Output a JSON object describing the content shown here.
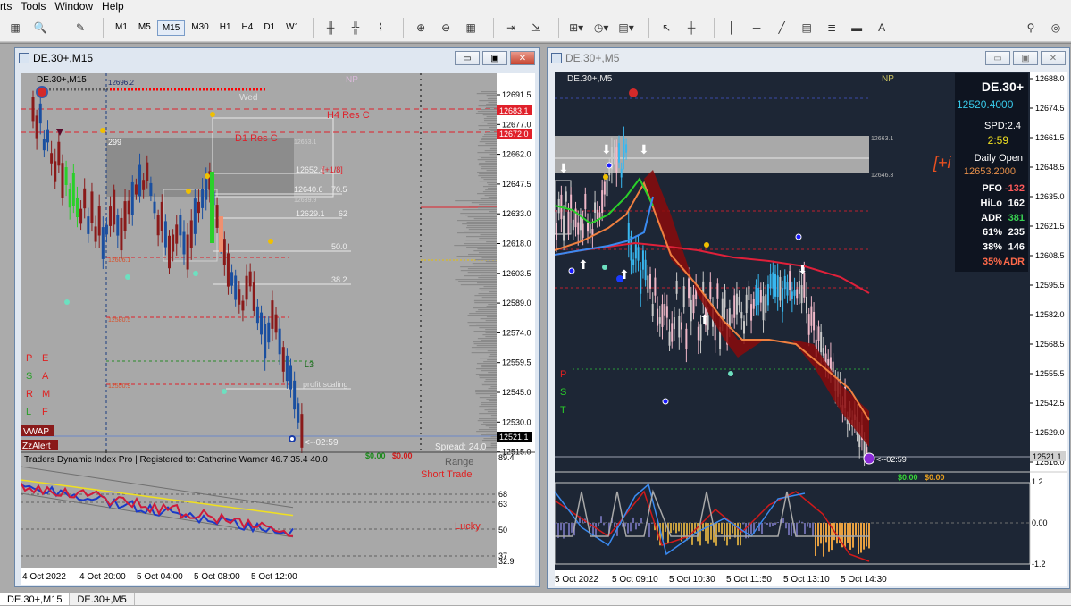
{
  "menu": [
    "rts",
    "Tools",
    "Window",
    "Help"
  ],
  "toolbar": {
    "timeframes": [
      "M1",
      "M5",
      "M15",
      "M30",
      "H1",
      "H4",
      "D1",
      "W1"
    ],
    "active_timeframe": "M15",
    "text_tool": "A"
  },
  "left_window": {
    "title": "DE.30+,M15",
    "chart_label": "DE.30+,M15",
    "price_levels": [
      "12691.5",
      "12677.0",
      "12662.0",
      "12647.5",
      "12633.0",
      "12618.0",
      "12603.5",
      "12589.0",
      "12574.0",
      "12559.5",
      "12545.0",
      "12530.0",
      "12515.0"
    ],
    "price_tags": [
      {
        "text": "12683.1",
        "color": "#e0202a"
      },
      {
        "text": "12672.0",
        "color": "#e0202a"
      },
      {
        "text": "12521.1",
        "color": "#000000"
      }
    ],
    "annotations": {
      "wed": "Wed",
      "np": "NP",
      "h4_res": "H4 Res C",
      "d1_res": "D1 Res C",
      "value_299": "299",
      "fib_1": "12652.4",
      "fib_1_tag": "[+1/8]",
      "fib_2": "12640.6",
      "fib_2_pct": "70.5",
      "fib_3": "12629.1",
      "fib_3_pct": "62",
      "pct_50": "50.0",
      "pct_38": "38.2",
      "l3": "L3",
      "profit_scaling": "profit scaling",
      "timer": "<--02:59",
      "spread": "Spread: 24.0",
      "top_line": "12696.2",
      "lvl_a": "12653.1",
      "lvl_b": "12639.9",
      "lvl_c": "12606.1",
      "lvl_d": "12580.5",
      "lvl_e": "12550.9"
    },
    "side_letters": [
      [
        "P",
        "E"
      ],
      [
        "S",
        "A"
      ],
      [
        "R",
        "M"
      ],
      [
        "L",
        "F"
      ]
    ],
    "badges": [
      "VWAP",
      "ZzAlert"
    ],
    "indicator": {
      "title": "Traders Dynamic Index Pro | Registered to: Catherine Warner 46.7 35.4 40.0",
      "profit": "$0.00",
      "loss": "$0.00",
      "range": "Range",
      "short_trade": "Short Trade",
      "lucky": "Lucky",
      "levels": [
        "89.4",
        "68",
        "63",
        "50",
        "37",
        "32.9"
      ]
    },
    "time_labels": [
      "4 Oct 2022",
      "4 Oct 20:00",
      "5 Oct 04:00",
      "5 Oct 08:00",
      "5 Oct 12:00"
    ]
  },
  "right_window": {
    "title": "DE.30+,M5",
    "chart_label": "DE.30+,M5",
    "np": "NP",
    "price_levels": [
      "12688.0",
      "12674.5",
      "12661.5",
      "12648.5",
      "12635.0",
      "12621.5",
      "12608.5",
      "12595.5",
      "12582.0",
      "12568.5",
      "12555.5",
      "12542.5",
      "12529.0",
      "12516.0"
    ],
    "price_tag": "12521.1",
    "zone_labels": [
      "12663.1",
      "12646.3"
    ],
    "timer": "<--02:59",
    "panel": {
      "symbol": "DE.30+",
      "price": "12520.4000",
      "spread": "SPD:2.4",
      "countdown": "2:59",
      "daily_open_label": "Daily Open",
      "daily_open": "12653.2000",
      "stats": [
        {
          "label": "PFO",
          "value": "-132",
          "color": "#ff5a5a"
        },
        {
          "label": "HiLo",
          "value": "162",
          "color": "#ffffff"
        },
        {
          "label": "ADR",
          "value": "381",
          "color": "#39d353"
        },
        {
          "label": "61%",
          "value": "235",
          "color": "#ffffff"
        },
        {
          "label": "38%",
          "value": "146",
          "color": "#ffffff"
        },
        {
          "label": "35%",
          "value": "ADR",
          "color": "#ff6a4a"
        }
      ],
      "overflow_text": "[+i"
    },
    "side_letters": [
      "P",
      "S",
      "T"
    ],
    "indicator": {
      "profit": "$0.00",
      "loss": "$0.00",
      "levels": [
        "1.2",
        "0.00",
        "-1.2"
      ]
    },
    "time_labels": [
      "5 Oct 2022",
      "5 Oct 09:10",
      "5 Oct 10:30",
      "5 Oct 11:50",
      "5 Oct 13:10",
      "5 Oct 14:30"
    ]
  },
  "status_tabs": [
    "DE.30+,M15",
    "DE.30+,M5"
  ],
  "colors": {
    "left_bg": "#a8a8a8",
    "right_bg": "#1d2635",
    "bull": "#1a4fa0",
    "bear": "#8a1a1a",
    "res": "#e0202a"
  }
}
